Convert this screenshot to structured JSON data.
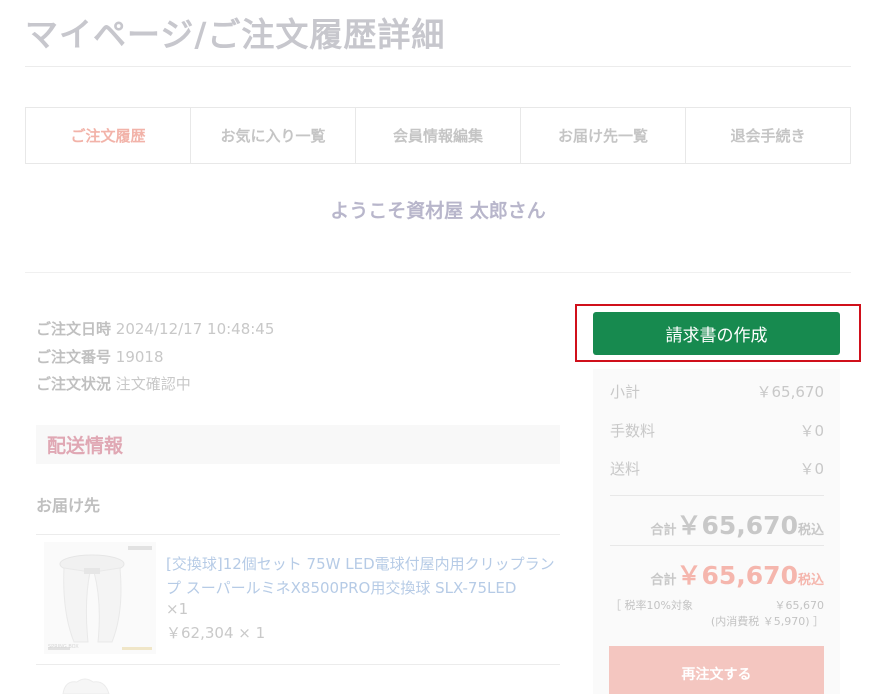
{
  "page": {
    "title": "マイページ/ご注文履歴詳細"
  },
  "tabs": [
    {
      "label": "ご注文履歴",
      "active": true
    },
    {
      "label": "お気に入り一覧"
    },
    {
      "label": "会員情報編集"
    },
    {
      "label": "お届け先一覧"
    },
    {
      "label": "退会手続き"
    }
  ],
  "welcome": "ようこそ資材屋 太郎さん",
  "order": {
    "date_label": "ご注文日時",
    "date": "2024/12/17 10:48:45",
    "number_label": "ご注文番号",
    "number": "19018",
    "status_label": "ご注文状況",
    "status": "注文確認中"
  },
  "delivery": {
    "heading": "配送情報",
    "destination_label": "お届け先"
  },
  "product": {
    "image_label": "SPRING BOX",
    "name": "[交換球]12個セット 75W LED電球付屋内用クリップランプ スーパールミネX8500PRO用交換球 SLX-75LED",
    "qty": "×1",
    "price": "￥62,304 × 1"
  },
  "summary": {
    "invoice_button": "請求書の作成",
    "subtotal_label": "小計",
    "subtotal": "￥65,670",
    "fee_label": "手数料",
    "fee": "￥0",
    "shipping_label": "送料",
    "shipping": "￥0",
    "total_label": "合計",
    "total": "￥65,670",
    "tax_included": "税込",
    "tax_target_label": "［ 税率10%対象",
    "tax_target_value": "￥65,670",
    "tax_inner": "(内消費税 ￥5,970) ］",
    "reorder_button": "再注文する"
  },
  "colors": {
    "invoice_green": "#178a4f",
    "highlight_red": "#d0101b",
    "accent_pink": "#f5b6ad"
  }
}
